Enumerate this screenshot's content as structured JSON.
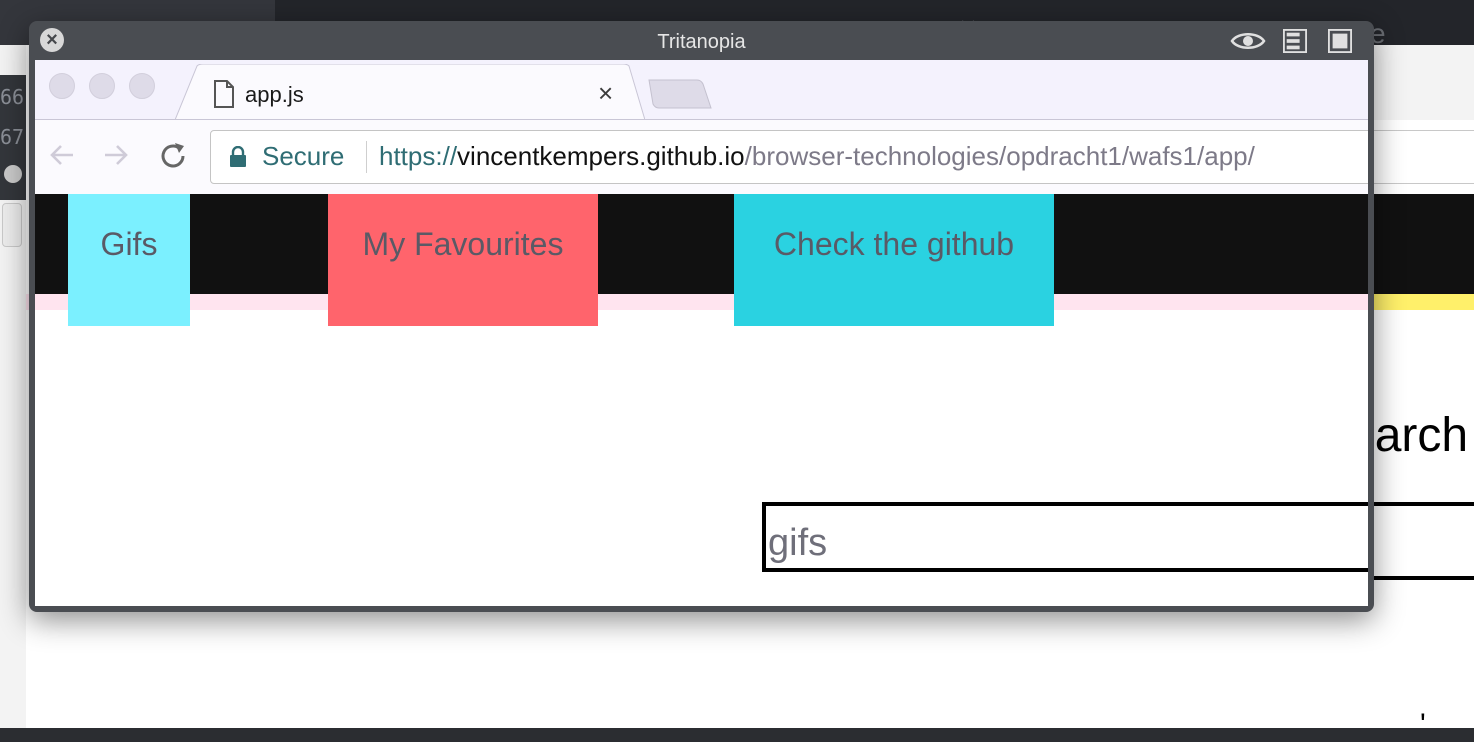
{
  "window": {
    "title": "Tritanopia",
    "close_icon": "close-icon",
    "eye_icon": "eye-icon",
    "layout_icon": "layout-icon",
    "fullscreen_icon": "fullscreen-icon"
  },
  "browser": {
    "tab": {
      "title": "app.js",
      "close_label": "×",
      "icon": "file-icon"
    },
    "nav": {
      "back_icon": "back-arrow-icon",
      "forward_icon": "forward-arrow-icon",
      "reload_icon": "reload-icon"
    },
    "omnibox": {
      "secure_label": "Secure",
      "url_scheme": "https://",
      "url_host": "vincentkempers.github.io",
      "url_path": "/browser-technologies/opdracht1/wafs1/app/"
    }
  },
  "page": {
    "nav": [
      {
        "label": "Gifs",
        "color": "#7bf0ff"
      },
      {
        "label": "My Favourites",
        "color": "#ff646c"
      },
      {
        "label": "Check the github",
        "color": "#2ad2e1"
      }
    ],
    "search_placeholder": "gifs"
  },
  "background": {
    "search_label": "Search",
    "line_numbers": [
      "66",
      "67"
    ],
    "ghost_text": "e"
  }
}
